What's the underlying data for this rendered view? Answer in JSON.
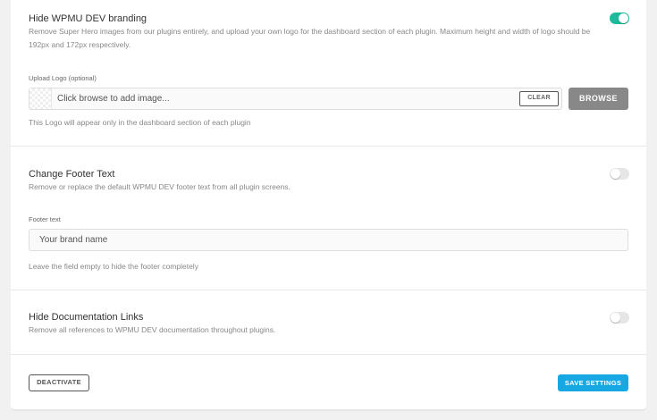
{
  "branding": {
    "title": "Hide WPMU DEV branding",
    "description": "Remove Super Hero images from our plugins entirely, and upload your own logo for the dashboard section of each plugin. Maximum height and width of logo should be 192px and 172px respectively.",
    "enabled": true,
    "upload_label": "Upload Logo (optional)",
    "upload_placeholder": "Click browse to add image...",
    "clear_label": "CLEAR",
    "browse_label": "BROWSE",
    "upload_help": "This Logo will appear only in the dashboard section of each plugin"
  },
  "footer": {
    "title": "Change Footer Text",
    "description": "Remove or replace the default WPMU DEV footer text from all plugin screens.",
    "enabled": false,
    "field_label": "Footer text",
    "placeholder": "Your brand name",
    "help": "Leave the field empty to hide the footer completely"
  },
  "docs": {
    "title": "Hide Documentation Links",
    "description": "Remove all references to WPMU DEV documentation throughout plugins.",
    "enabled": false
  },
  "actions": {
    "deactivate_label": "DEACTIVATE",
    "save_label": "SAVE SETTINGS"
  },
  "colors": {
    "toggle_on": "#1abc9c",
    "save_button": "#17a8e3",
    "browse_button": "#888888"
  }
}
